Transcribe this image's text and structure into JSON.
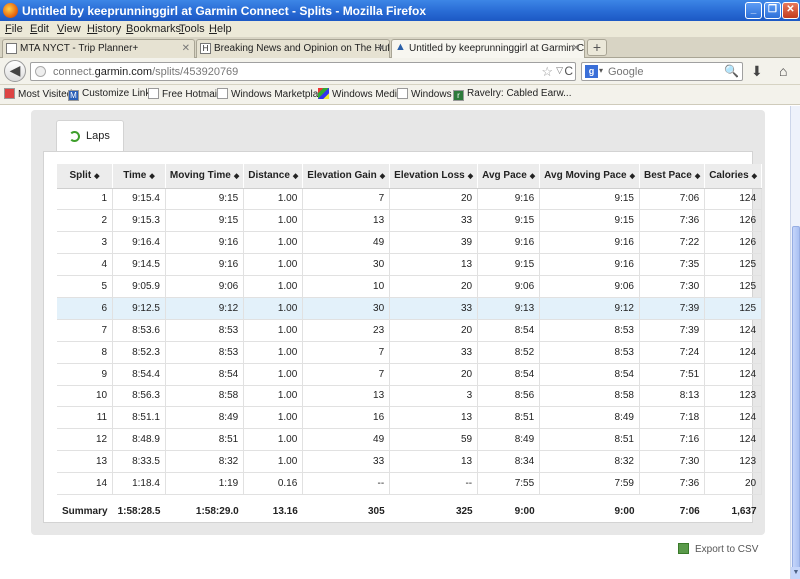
{
  "window": {
    "title": "Untitled by keeprunninggirl at Garmin Connect - Splits - Mozilla Firefox",
    "controls": [
      "_",
      "❐",
      "✕"
    ]
  },
  "menu": [
    {
      "letter": "F",
      "rest": "ile"
    },
    {
      "letter": "E",
      "rest": "dit"
    },
    {
      "letter": "V",
      "rest": "iew"
    },
    {
      "letter": "Hi",
      "rest": "story"
    },
    {
      "letter": "B",
      "rest": "ookmarks"
    },
    {
      "letter": "T",
      "rest": "ools"
    },
    {
      "letter": "H",
      "rest": "elp"
    }
  ],
  "tabs": [
    {
      "label": "MTA NYCT - Trip Planner+",
      "icon": ""
    },
    {
      "label": "Breaking News and Opinion on The Huffin...",
      "icon": "H"
    },
    {
      "label": "Untitled by keeprunninggirl at Garmin Co...",
      "icon": "▲"
    }
  ],
  "newtab": "+",
  "nav": {
    "back": "◀",
    "url_prefix": "connect.",
    "url_domain": "garmin.com",
    "url_path": "/splits/453920769",
    "search_placeholder": "Google",
    "search_engine": "g",
    "star": "☆",
    "dropdown": "▽",
    "reload": "C",
    "download": "⬇",
    "home": "⌂",
    "magnifier": "🔍",
    "engine_dropdown": "▾"
  },
  "bookmarks": [
    {
      "label": "Most Visited",
      "icon": ""
    },
    {
      "label": "Customize Links",
      "icon": "M"
    },
    {
      "label": "Free Hotmail",
      "icon": ""
    },
    {
      "label": "Windows Marketplace",
      "icon": ""
    },
    {
      "label": "Windows Media",
      "icon": ""
    },
    {
      "label": "Windows",
      "icon": ""
    },
    {
      "label": "Ravelry: Cabled Earw...",
      "icon": "r"
    }
  ],
  "laps_tab": "Laps",
  "table": {
    "columns": [
      "Split",
      "Time",
      "Moving Time",
      "Distance",
      "Elevation Gain",
      "Elevation Loss",
      "Avg Pace",
      "Avg Moving Pace",
      "Best Pace",
      "Calories"
    ],
    "sort_arrow": "◆",
    "highlight_row": 5,
    "rows": [
      [
        "1",
        "9:15.4",
        "9:15",
        "1.00",
        "7",
        "20",
        "9:16",
        "9:15",
        "7:06",
        "124"
      ],
      [
        "2",
        "9:15.3",
        "9:15",
        "1.00",
        "13",
        "33",
        "9:15",
        "9:15",
        "7:36",
        "126"
      ],
      [
        "3",
        "9:16.4",
        "9:16",
        "1.00",
        "49",
        "39",
        "9:16",
        "9:16",
        "7:22",
        "126"
      ],
      [
        "4",
        "9:14.5",
        "9:16",
        "1.00",
        "30",
        "13",
        "9:15",
        "9:16",
        "7:35",
        "125"
      ],
      [
        "5",
        "9:05.9",
        "9:06",
        "1.00",
        "10",
        "20",
        "9:06",
        "9:06",
        "7:30",
        "125"
      ],
      [
        "6",
        "9:12.5",
        "9:12",
        "1.00",
        "30",
        "33",
        "9:13",
        "9:12",
        "7:39",
        "125"
      ],
      [
        "7",
        "8:53.6",
        "8:53",
        "1.00",
        "23",
        "20",
        "8:54",
        "8:53",
        "7:39",
        "124"
      ],
      [
        "8",
        "8:52.3",
        "8:53",
        "1.00",
        "7",
        "33",
        "8:52",
        "8:53",
        "7:24",
        "124"
      ],
      [
        "9",
        "8:54.4",
        "8:54",
        "1.00",
        "7",
        "20",
        "8:54",
        "8:54",
        "7:51",
        "124"
      ],
      [
        "10",
        "8:56.3",
        "8:58",
        "1.00",
        "13",
        "3",
        "8:56",
        "8:58",
        "8:13",
        "123"
      ],
      [
        "11",
        "8:51.1",
        "8:49",
        "1.00",
        "16",
        "13",
        "8:51",
        "8:49",
        "7:18",
        "124"
      ],
      [
        "12",
        "8:48.9",
        "8:51",
        "1.00",
        "49",
        "59",
        "8:49",
        "8:51",
        "7:16",
        "124"
      ],
      [
        "13",
        "8:33.5",
        "8:32",
        "1.00",
        "33",
        "13",
        "8:34",
        "8:32",
        "7:30",
        "123"
      ],
      [
        "14",
        "1:18.4",
        "1:19",
        "0.16",
        "--",
        "--",
        "7:55",
        "7:59",
        "7:36",
        "20"
      ]
    ],
    "summary": [
      "Summary",
      "1:58:28.5",
      "1:58:29.0",
      "13.16",
      "305",
      "325",
      "9:00",
      "9:00",
      "7:06",
      "1,637"
    ]
  },
  "export_label": "Export to CSV",
  "scroll_down": "▼",
  "colors": {
    "highlight_row": "#e3f1fa",
    "header_bg": "#ececec",
    "panel_bg": "#e7e7e7",
    "titlebar": "#2a6dd6",
    "laps_icon": "#3d9e2a"
  }
}
